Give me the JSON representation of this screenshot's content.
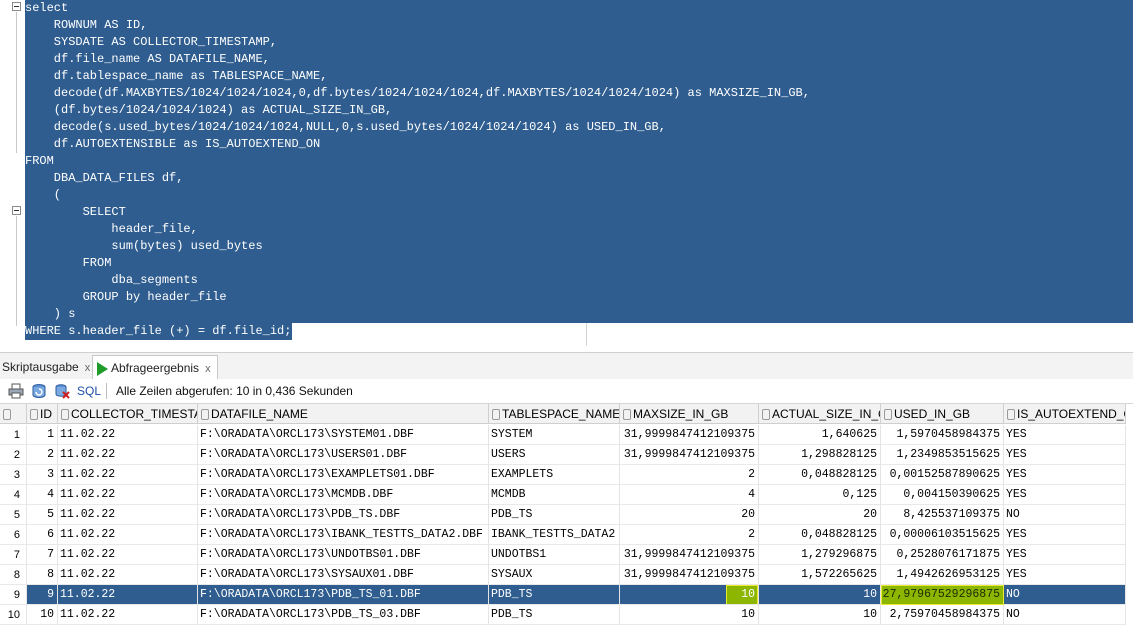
{
  "editor": {
    "lines": [
      "select",
      "    ROWNUM AS ID,",
      "    SYSDATE AS COLLECTOR_TIMESTAMP,",
      "    df.file_name AS DATAFILE_NAME,",
      "    df.tablespace_name as TABLESPACE_NAME,",
      "    decode(df.MAXBYTES/1024/1024/1024,0,df.bytes/1024/1024/1024,df.MAXBYTES/1024/1024/1024) as MAXSIZE_IN_GB,",
      "    (df.bytes/1024/1024/1024) as ACTUAL_SIZE_IN_GB,",
      "    decode(s.used_bytes/1024/1024/1024,NULL,0,s.used_bytes/1024/1024/1024) as USED_IN_GB,",
      "    df.AUTOEXTENSIBLE as IS_AUTOEXTEND_ON",
      "FROM",
      "    DBA_DATA_FILES df,",
      "    (",
      "        SELECT",
      "            header_file,",
      "            sum(bytes) used_bytes",
      "        FROM",
      "            dba_segments",
      "        GROUP by header_file",
      "    ) s",
      "WHERE s.header_file (+) = df.file_id;"
    ]
  },
  "tabs": [
    {
      "label": "Skriptausgabe",
      "close": "x"
    },
    {
      "label": "Abfrageergebnis",
      "close": "x"
    }
  ],
  "toolbar": {
    "sql_label": "SQL",
    "separator": "|",
    "status": "Alle Zeilen abgerufen: 10 in 0,436 Sekunden",
    "icons": [
      "print-icon",
      "refresh-icon",
      "delete-icon"
    ]
  },
  "grid": {
    "columns": [
      "ID",
      "COLLECTOR_TIMESTAMP",
      "DATAFILE_NAME",
      "TABLESPACE_NAME",
      "MAXSIZE_IN_GB",
      "ACTUAL_SIZE_IN_GB",
      "USED_IN_GB",
      "IS_AUTOEXTEND_ON"
    ],
    "rows": [
      {
        "n": "1",
        "id": "1",
        "ts": "11.02.22",
        "file": "F:\\ORADATA\\ORCL173\\SYSTEM01.DBF",
        "tbs": "SYSTEM",
        "max": "31,9999847412109375",
        "act": "1,640625",
        "used": "1,5970458984375",
        "auto": "YES"
      },
      {
        "n": "2",
        "id": "2",
        "ts": "11.02.22",
        "file": "F:\\ORADATA\\ORCL173\\USERS01.DBF",
        "tbs": "USERS",
        "max": "31,9999847412109375",
        "act": "1,298828125",
        "used": "1,2349853515625",
        "auto": "YES"
      },
      {
        "n": "3",
        "id": "3",
        "ts": "11.02.22",
        "file": "F:\\ORADATA\\ORCL173\\EXAMPLETS01.DBF",
        "tbs": "EXAMPLETS",
        "max": "2",
        "act": "0,048828125",
        "used": "0,00152587890625",
        "auto": "YES"
      },
      {
        "n": "4",
        "id": "4",
        "ts": "11.02.22",
        "file": "F:\\ORADATA\\ORCL173\\MCMDB.DBF",
        "tbs": "MCMDB",
        "max": "4",
        "act": "0,125",
        "used": "0,004150390625",
        "auto": "YES"
      },
      {
        "n": "5",
        "id": "5",
        "ts": "11.02.22",
        "file": "F:\\ORADATA\\ORCL173\\PDB_TS.DBF",
        "tbs": "PDB_TS",
        "max": "20",
        "act": "20",
        "used": "8,425537109375",
        "auto": "NO"
      },
      {
        "n": "6",
        "id": "6",
        "ts": "11.02.22",
        "file": "F:\\ORADATA\\ORCL173\\IBANK_TESTTS_DATA2.DBF",
        "tbs": "IBANK_TESTTS_DATA2",
        "max": "2",
        "act": "0,048828125",
        "used": "0,00006103515625",
        "auto": "YES"
      },
      {
        "n": "7",
        "id": "7",
        "ts": "11.02.22",
        "file": "F:\\ORADATA\\ORCL173\\UNDOTBS01.DBF",
        "tbs": "UNDOTBS1",
        "max": "31,9999847412109375",
        "act": "1,279296875",
        "used": "0,2528076171875",
        "auto": "YES"
      },
      {
        "n": "8",
        "id": "8",
        "ts": "11.02.22",
        "file": "F:\\ORADATA\\ORCL173\\SYSAUX01.DBF",
        "tbs": "SYSAUX",
        "max": "31,9999847412109375",
        "act": "1,572265625",
        "used": "1,4942626953125",
        "auto": "YES"
      },
      {
        "n": "9",
        "id": "9",
        "ts": "11.02.22",
        "file": "F:\\ORADATA\\ORCL173\\PDB_TS_01.DBF",
        "tbs": "PDB_TS",
        "max": "10",
        "act": "10",
        "used": "27,97967529296875",
        "auto": "NO"
      },
      {
        "n": "10",
        "id": "10",
        "ts": "11.02.22",
        "file": "F:\\ORADATA\\ORCL173\\PDB_TS_03.DBF",
        "tbs": "PDB_TS",
        "max": "10",
        "act": "10",
        "used": "2,75970458984375",
        "auto": "NO"
      }
    ],
    "selected_row": 9,
    "highlight_color": "#8cb600",
    "selection_color": "#2f5d8f"
  }
}
